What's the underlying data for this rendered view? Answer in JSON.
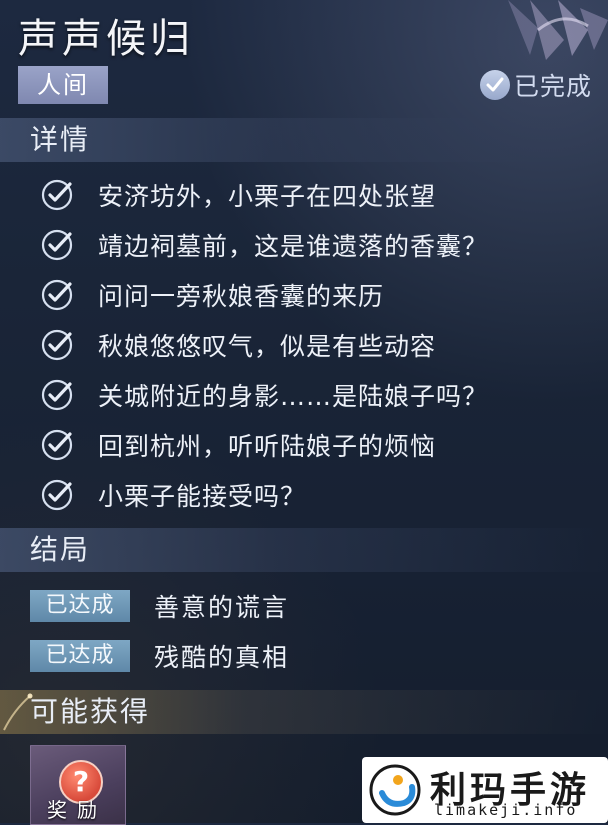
{
  "quest": {
    "title": "声声候归",
    "category_tag": "人间",
    "status_text": "已完成"
  },
  "details": {
    "section_title": "详情",
    "tasks": [
      "安济坊外，小栗子在四处张望",
      "靖边祠墓前，这是谁遗落的香囊？",
      "问问一旁秋娘香囊的来历",
      "秋娘悠悠叹气，似是有些动容",
      "关城附近的身影……是陆娘子吗？",
      "回到杭州，听听陆娘子的烦恼",
      "小栗子能接受吗？"
    ]
  },
  "endings": {
    "section_title": "结局",
    "items": [
      {
        "badge": "已达成",
        "text": "善意的谎言"
      },
      {
        "badge": "已达成",
        "text": "残酷的真相"
      }
    ]
  },
  "rewards": {
    "section_title": "可能获得",
    "items": [
      {
        "label": "奖励",
        "icon": "question-mark-icon"
      }
    ]
  },
  "watermark": {
    "name": "利玛手游",
    "url": "limakeji.info"
  },
  "colors": {
    "background": "#1a2538",
    "category_tag": "#8c95bc",
    "ending_badge": "#6e98b6",
    "check_icon": "#d6e0f0"
  }
}
